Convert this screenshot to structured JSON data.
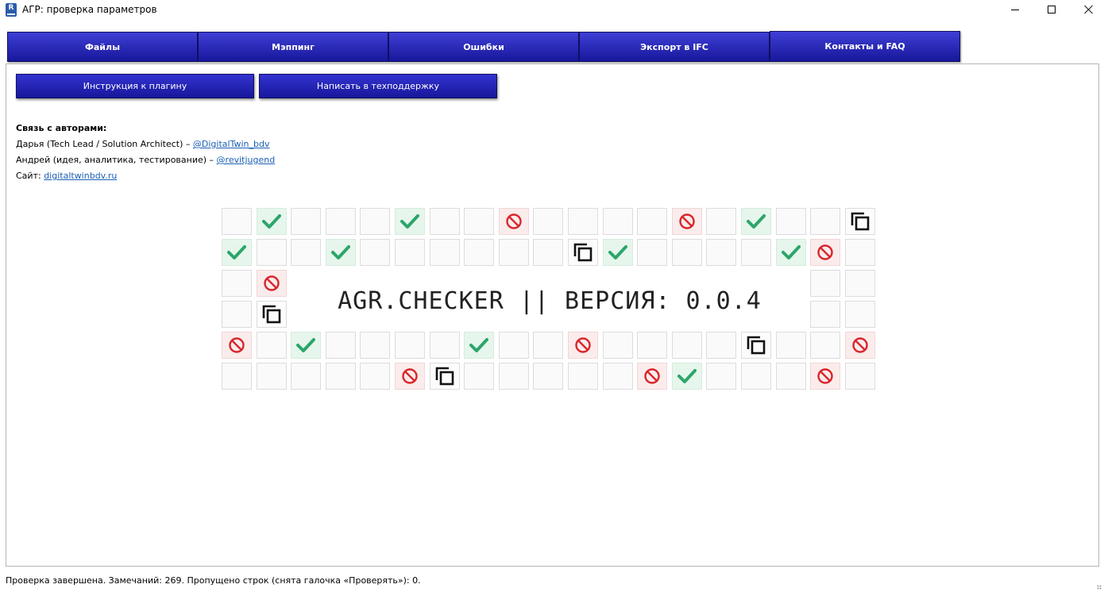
{
  "window": {
    "title": "АГР: проверка параметров",
    "app_icon": "revit-icon",
    "app_icon_letter": "R",
    "controls": [
      "minimize-icon",
      "maximize-icon",
      "close-icon"
    ]
  },
  "tabs": [
    {
      "label": "Файлы",
      "active": false
    },
    {
      "label": "Мэппинг",
      "active": false
    },
    {
      "label": "Ошибки",
      "active": false
    },
    {
      "label": "Экспорт в IFC",
      "active": false
    },
    {
      "label": "Контакты и FAQ",
      "active": true
    }
  ],
  "actions": {
    "instruction_label": "Инструкция к плагину",
    "support_label": "Написать в техподдержку"
  },
  "contacts": {
    "heading": "Связь с авторами:",
    "line1_text": "Дарья (Tech Lead / Solution Architect) – ",
    "line1_link": "@DigitalTwin_bdv",
    "line2_text": "Андрей (идея, аналитика, тестирование) – ",
    "line2_link": "@revitjugend",
    "line3_text": "Сайт: ",
    "line3_link": "digitaltwinbdv.ru"
  },
  "banner": {
    "text": "AGR.CHECKER || ВЕРСИЯ: 0.0.4"
  },
  "icon_grid": {
    "legend": {
      "ok": "checkmark-icon",
      "bad": "prohibited-icon",
      "copy": "copy-icon",
      "empty": "empty"
    },
    "rows": [
      [
        "empty",
        "ok",
        "empty",
        "empty",
        "empty",
        "ok",
        "empty",
        "empty",
        "bad",
        "empty",
        "empty",
        "empty",
        "empty",
        "bad",
        "empty",
        "ok",
        "empty",
        "empty",
        "copy"
      ],
      [
        "ok",
        "empty",
        "empty",
        "ok",
        "empty",
        "empty",
        "empty",
        "empty",
        "empty",
        "empty",
        "copy",
        "ok",
        "empty",
        "empty",
        "empty",
        "empty",
        "ok",
        "bad",
        "empty"
      ],
      [
        "empty",
        "bad",
        null,
        null,
        null,
        null,
        null,
        null,
        null,
        null,
        null,
        null,
        null,
        null,
        null,
        null,
        null,
        "empty",
        "empty"
      ],
      [
        "empty",
        "copy",
        null,
        null,
        null,
        null,
        null,
        null,
        null,
        null,
        null,
        null,
        null,
        null,
        null,
        null,
        null,
        "empty",
        "empty"
      ],
      [
        "bad",
        "empty",
        "ok",
        "empty",
        "empty",
        "empty",
        "empty",
        "ok",
        "empty",
        "empty",
        "bad",
        "empty",
        "empty",
        "empty",
        "empty",
        "copy",
        "empty",
        "empty",
        "bad"
      ],
      [
        "empty",
        "empty",
        "empty",
        "empty",
        "empty",
        "bad",
        "copy",
        "empty",
        "empty",
        "empty",
        "empty",
        "empty",
        "bad",
        "ok",
        "empty",
        "empty",
        "empty",
        "bad",
        "empty"
      ]
    ]
  },
  "colors": {
    "tab_gradient_top": "#3f3fd6",
    "tab_gradient_bottom": "#17179b",
    "ok": "#2ba66a",
    "bad": "#d9262b",
    "link": "#1a5fb4"
  },
  "status_bar": {
    "text": "Проверка завершена. Замечаний: 269. Пропущено строк (снята галочка «Проверять»): 0."
  }
}
